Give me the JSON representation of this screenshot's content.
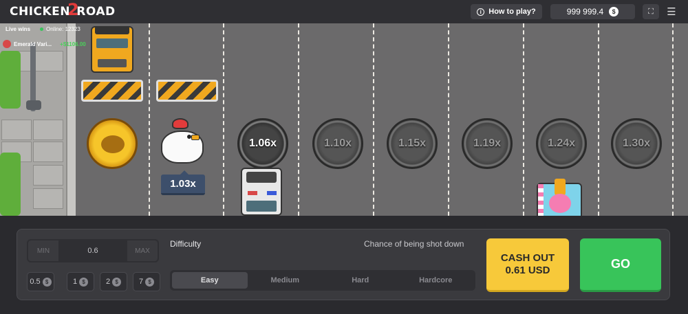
{
  "header": {
    "logo_left": "CHICKEN",
    "logo_mid": "2",
    "logo_right": "ROAD",
    "how_to_play": "How to play?",
    "balance": "999 999.4",
    "currency_symbol": "$"
  },
  "live": {
    "label": "Live wins",
    "online": "Online: 12323",
    "win_user": "Emerald Vari...",
    "win_amount": "+$1106.00"
  },
  "lanes": {
    "chicken_multiplier": "1.03x",
    "multipliers": [
      "1.06x",
      "1.10x",
      "1.15x",
      "1.19x",
      "1.24x",
      "1.30x"
    ]
  },
  "controls": {
    "min_label": "MIN",
    "max_label": "MAX",
    "bet_value": "0.6",
    "chips": [
      "0.5",
      "1",
      "2",
      "7"
    ],
    "difficulty_label": "Difficulty",
    "chance_label": "Chance of being shot down",
    "difficulties": [
      "Easy",
      "Medium",
      "Hard",
      "Hardcore"
    ],
    "selected_difficulty": "Easy",
    "cashout_line1": "CASH OUT",
    "cashout_line2": "0.61 USD",
    "go_label": "GO"
  },
  "colors": {
    "cashout": "#f7c93a",
    "go": "#38c45a",
    "win_amount": "#4bd15a",
    "logo_accent": "#e23b3b"
  }
}
